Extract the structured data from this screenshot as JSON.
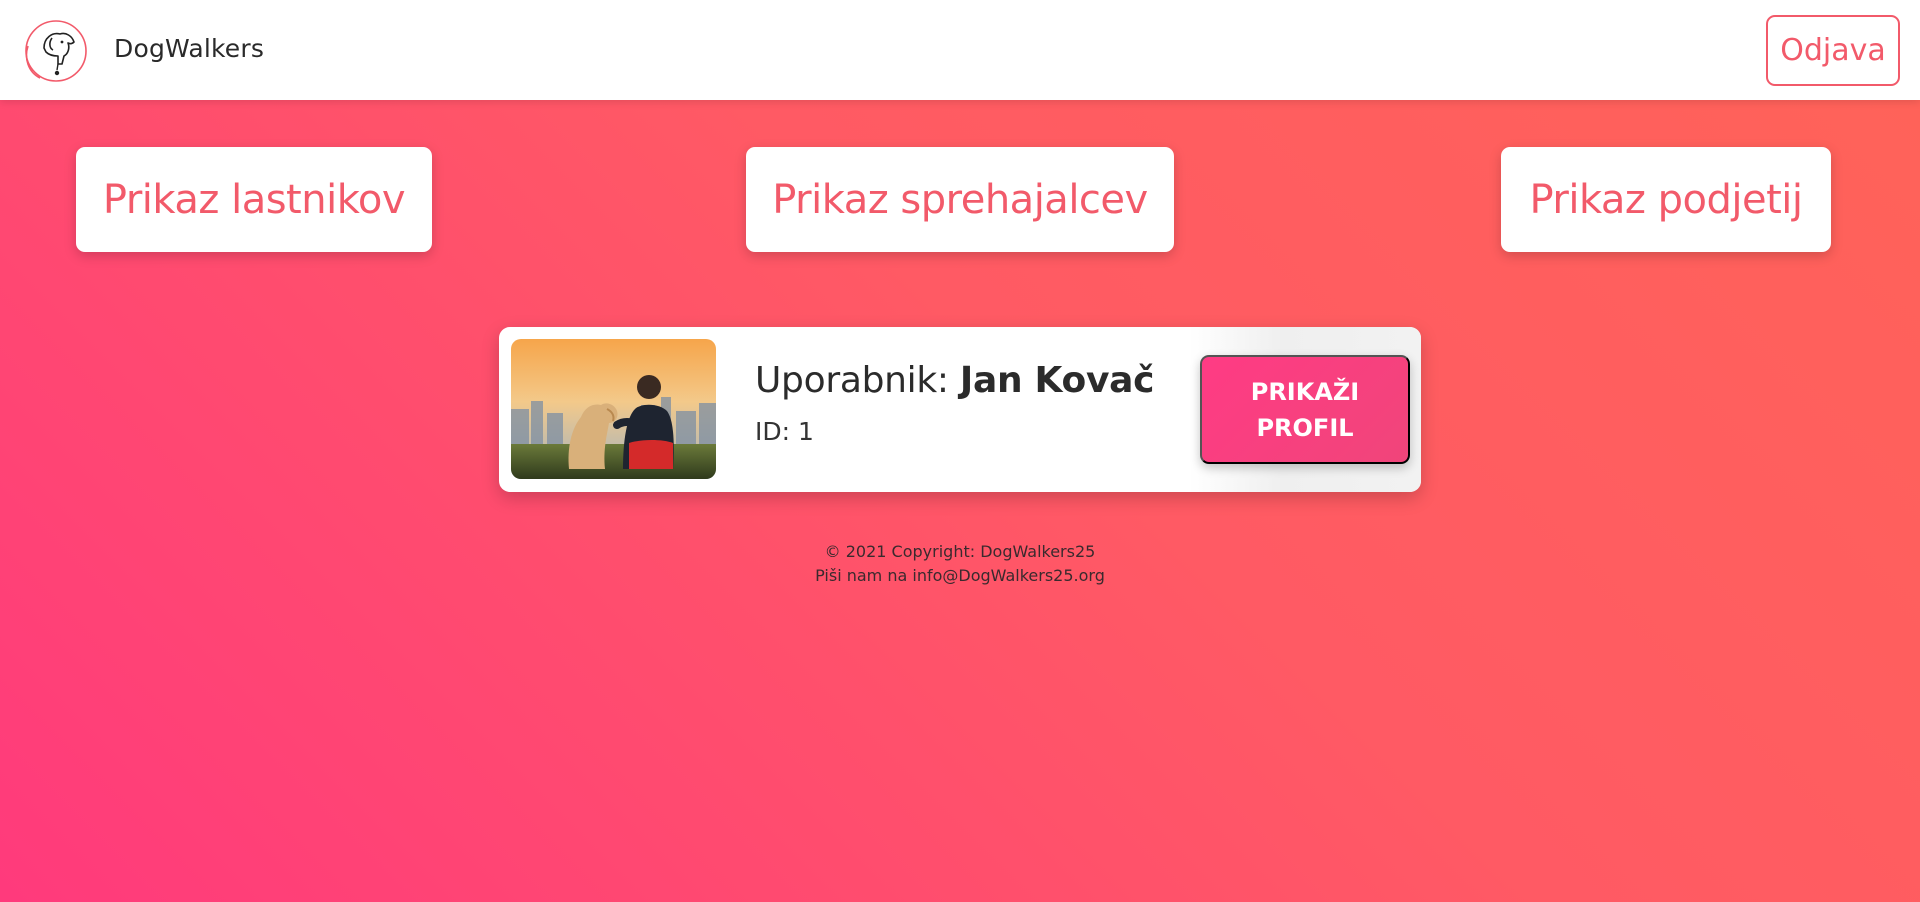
{
  "navbar": {
    "brand": "DogWalkers",
    "logout_label": "Odjava"
  },
  "nav_cards": {
    "owners": "Prikaz lastnikov",
    "walkers": "Prikaz sprehajalcev",
    "companies": "Prikaz podjetij"
  },
  "user_card": {
    "name_label": "Uporabnik:",
    "name_value": "Jan Kovač",
    "id_text": "ID: 1",
    "profile_button": "PRIKAŽI PROFIL"
  },
  "footer": {
    "copyright": "© 2021 Copyright: DogWalkers25",
    "contact_prefix": "Piši nam na",
    "email": "info@DogWalkers25.org"
  },
  "colors": {
    "accent": "#f25a6a",
    "button_pink": "#ff3b84",
    "background_start": "#ff3a7c",
    "background_end": "#ff6358"
  },
  "icons": {
    "logo": "dog-logo-icon"
  }
}
